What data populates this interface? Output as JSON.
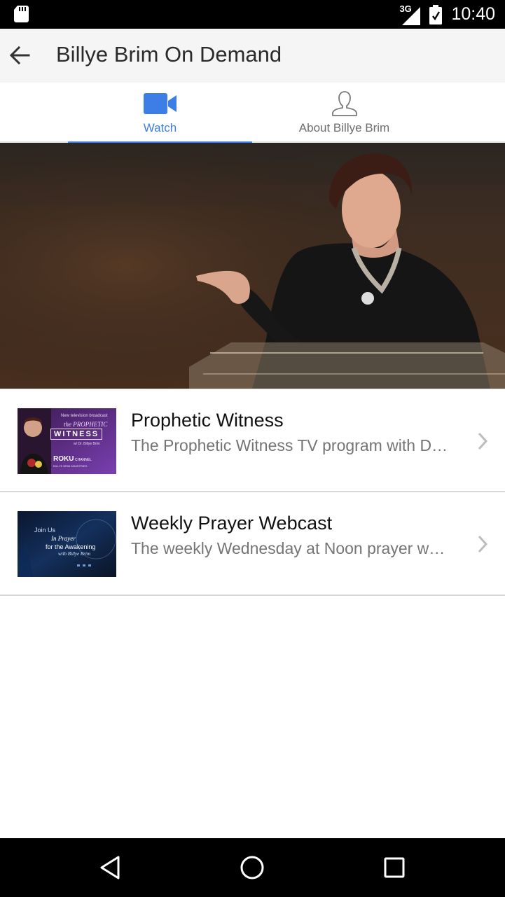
{
  "status_bar": {
    "network": "3G",
    "time": "10:40"
  },
  "app_bar": {
    "title": "Billye Brim On Demand",
    "back_icon": "arrow-back-icon"
  },
  "tabs": [
    {
      "label": "Watch",
      "icon": "video-camera-icon",
      "active": true
    },
    {
      "label": "About Billye Brim",
      "icon": "person-outline-icon",
      "active": false
    }
  ],
  "colors": {
    "accent": "#3c7ee6",
    "app_bar_bg": "#f5f5f5",
    "title_text": "#2a2a2a",
    "subtitle_text": "#757575"
  },
  "list": [
    {
      "title": "Prophetic Witness",
      "subtitle": "The Prophetic Witness TV program with Dr. Billye Brim",
      "thumb_text": {
        "line1": "New television broadcast",
        "line2": "the PROPHETIC",
        "line3": "WITNESS",
        "line4": "w/ Dr. Billye Brim",
        "line5": "ROKU",
        "line6": "CHANNEL",
        "line7": "BILLYE BRIM MINISTRIES"
      }
    },
    {
      "title": "Weekly Prayer Webcast",
      "subtitle": "The weekly Wednesday at Noon prayer webcast",
      "thumb_text": {
        "line1": "Join Us",
        "line2": "In Prayer",
        "line3": "for the Awakening",
        "line4": "with Billye Brim"
      }
    }
  ]
}
